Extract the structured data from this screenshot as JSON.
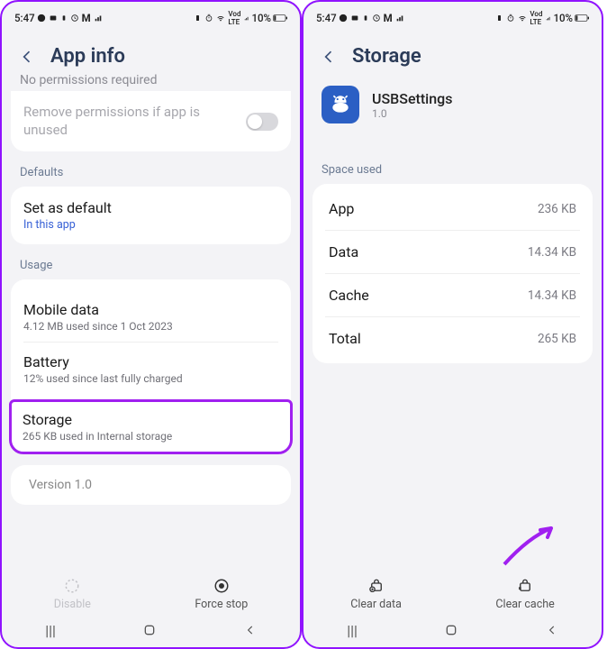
{
  "status": {
    "time": "5:47",
    "battery": "10%",
    "icons_left": "🟢 📷 🔋 ⏰ M 📶",
    "icons_right": "🔋 ⏰ 📶 📶 ⌁"
  },
  "left": {
    "title": "App info",
    "truncated": "No permissions required",
    "removePerm": "Remove permissions if app is unused",
    "defaults_label": "Defaults",
    "setDefault": {
      "title": "Set as default",
      "sub": "In this app"
    },
    "usage_label": "Usage",
    "mobile": {
      "title": "Mobile data",
      "sub": "4.12 MB used since 1 Oct 2023"
    },
    "battery": {
      "title": "Battery",
      "sub": "12% used since last fully charged"
    },
    "storage": {
      "title": "Storage",
      "sub": "265 KB used in Internal storage"
    },
    "version": "Version 1.0",
    "disable": "Disable",
    "forceStop": "Force stop"
  },
  "right": {
    "title": "Storage",
    "appName": "USBSettings",
    "appVer": "1.0",
    "space_label": "Space used",
    "rows": {
      "app": {
        "k": "App",
        "v": "236 KB"
      },
      "data": {
        "k": "Data",
        "v": "14.34 KB"
      },
      "cache": {
        "k": "Cache",
        "v": "14.34 KB"
      },
      "total": {
        "k": "Total",
        "v": "265 KB"
      }
    },
    "clearData": "Clear data",
    "clearCache": "Clear cache"
  }
}
